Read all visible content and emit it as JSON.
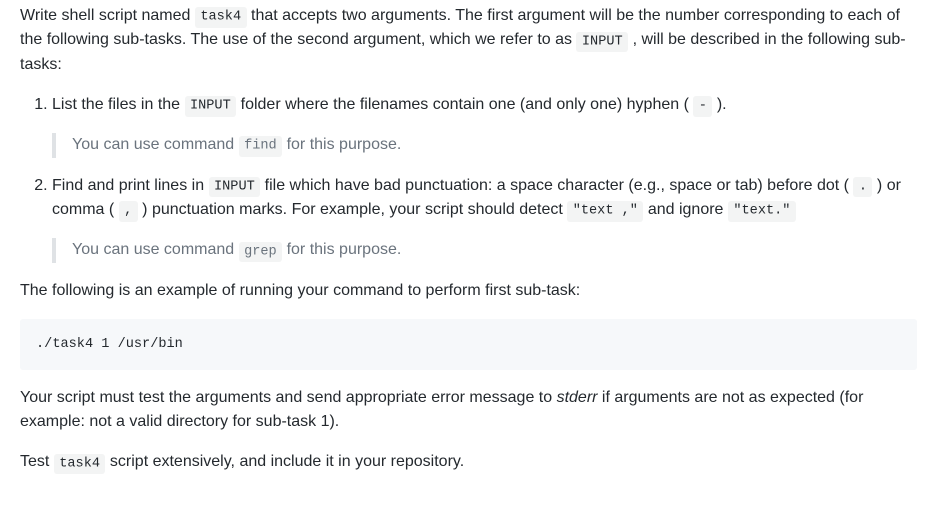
{
  "intro": {
    "part1": "Write shell script named ",
    "code1": "task4",
    "part2": " that accepts two arguments. The first argument will be the number corresponding to each of the following sub-tasks. The use of the second argument, which we refer to as ",
    "code2": "INPUT",
    "part3": " , will be described in the following sub-tasks:"
  },
  "task1": {
    "p1": "List the files in the ",
    "c1": "INPUT",
    "p2": " folder where the filenames contain one (and only one) hyphen ( ",
    "c2": "-",
    "p3": " )."
  },
  "hint1": {
    "p1": "You can use command ",
    "c1": "find",
    "p2": " for this purpose."
  },
  "task2": {
    "p1": "Find and print lines in ",
    "c1": "INPUT",
    "p2": " file which have bad punctuation: a space character (e.g., space or tab) before dot ( ",
    "c2": ".",
    "p3": " ) or comma ( ",
    "c3": ",",
    "p4": " ) punctuation marks. For example, your script should detect ",
    "c4": "\"text ,\"",
    "p5": " and ignore ",
    "c5": "\"text.\""
  },
  "hint2": {
    "p1": "You can use command ",
    "c1": "grep",
    "p2": " for this purpose."
  },
  "example_intro": "The following is an example of running your command to perform first sub-task:",
  "example_cmd": "./task4 1 /usr/bin",
  "stderr_note": {
    "p1": "Your script must test the arguments and send appropriate error message to ",
    "em1": "stderr",
    "p2": " if arguments are not as expected (for example: not a valid directory for sub-task 1)."
  },
  "closing": {
    "p1": "Test ",
    "c1": "task4",
    "p2": " script extensively, and include it in your repository."
  }
}
